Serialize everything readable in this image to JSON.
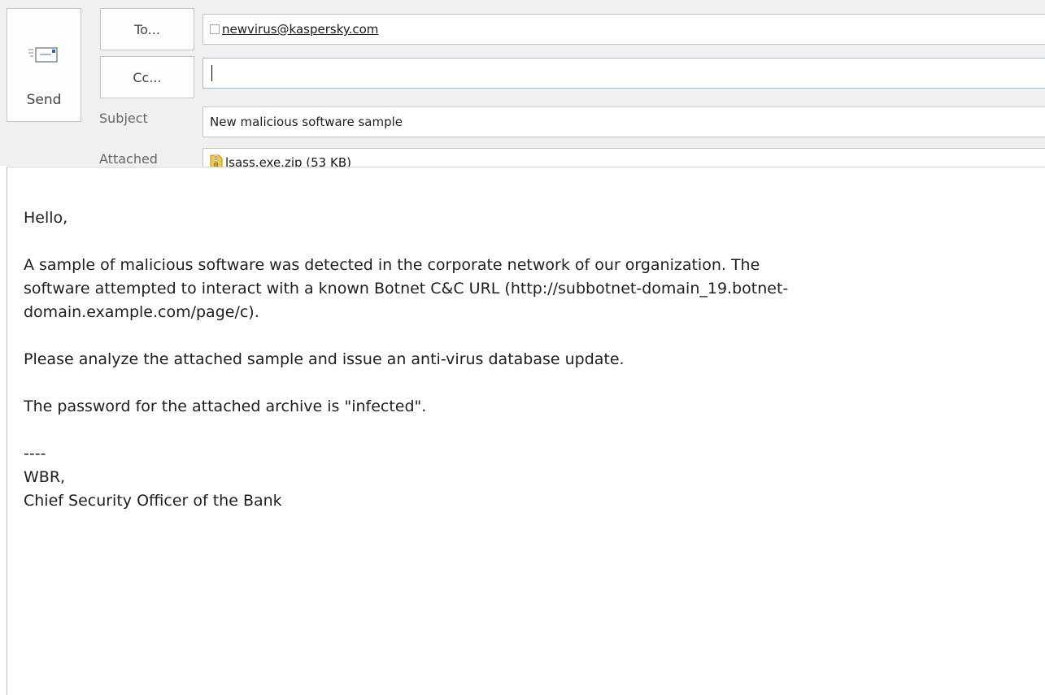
{
  "header": {
    "send_label": "Send",
    "to_label": "To...",
    "cc_label": "Cc...",
    "subject_label": "Subject",
    "attached_label": "Attached",
    "to_value": "newvirus@kaspersky.com",
    "cc_value": "",
    "subject_value": "New malicious software sample",
    "attachment": "lsass.exe.zip (53 KB)"
  },
  "body": {
    "greeting": "Hello,",
    "para1_line1": "A sample of malicious software was detected in the corporate network of our organization. The",
    "para1_line2": "software attempted to interact with a known Botnet C&C URL (http://subbotnet-domain_19.botnet-",
    "para1_line3": "domain.example.com/page/c).",
    "para2": "Please analyze the attached sample and issue an anti-virus database update.",
    "para3": "The password for the attached archive is \"infected\".",
    "sig_divider": "----",
    "sig_line1": "WBR,",
    "sig_line2": "Chief Security Officer of the Bank"
  },
  "icons": {
    "send": "send-envelope-icon",
    "attachment": "zip-archive-icon",
    "recipient_checkbox": "checkbox-icon"
  }
}
